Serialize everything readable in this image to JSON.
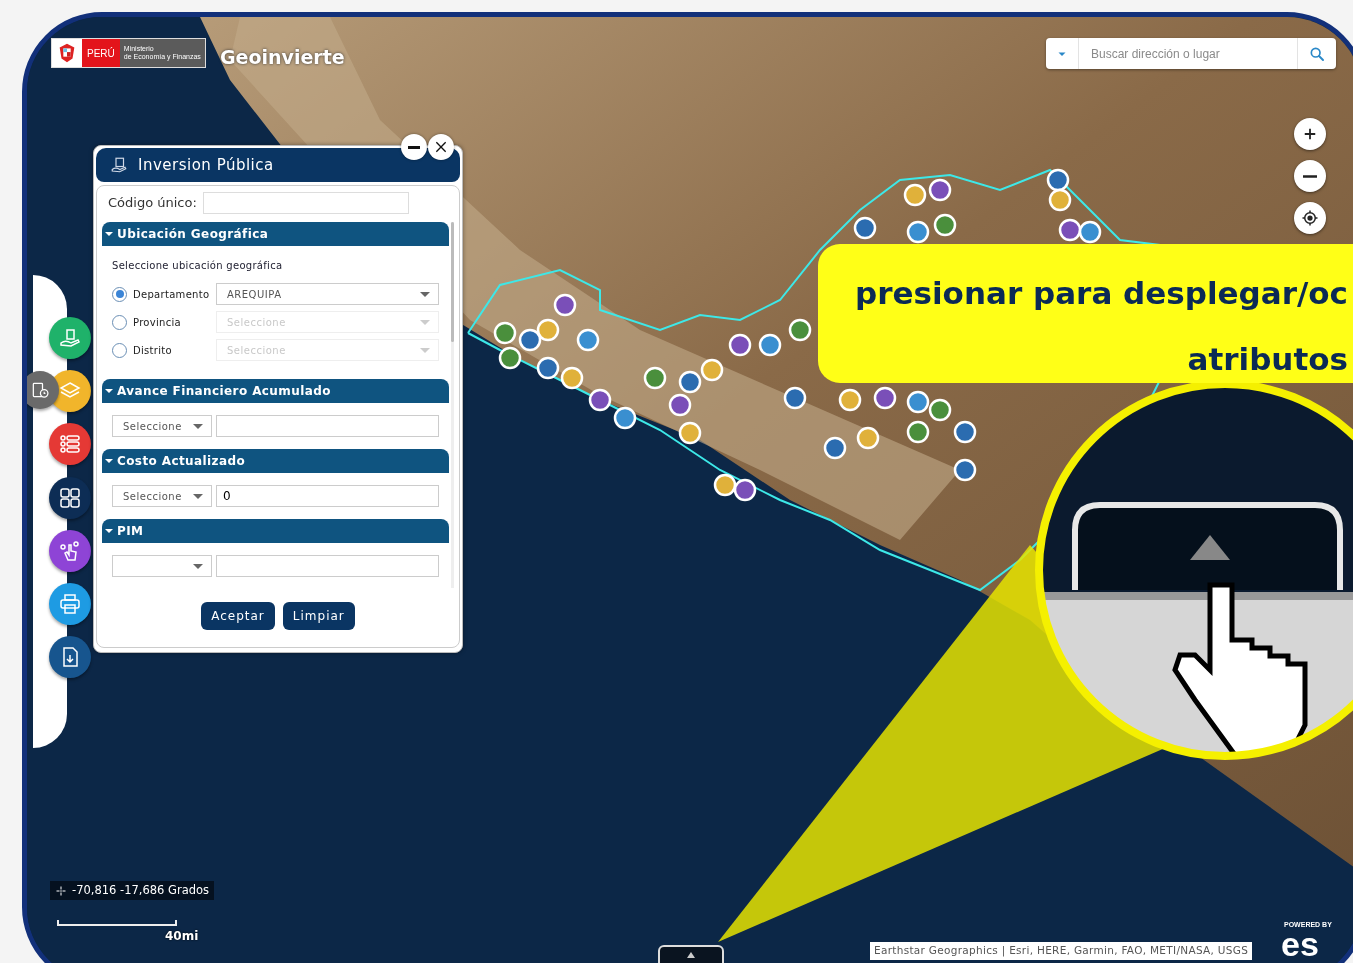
{
  "header": {
    "country": "PERÚ",
    "ministry": [
      "Ministerio",
      "de Economía y Finanzas"
    ],
    "app_title": "Geoinvierte"
  },
  "search": {
    "placeholder": "Buscar dirección o lugar"
  },
  "toolbar": {
    "tools": [
      {
        "color": "#1fb26a"
      },
      {
        "color": "#f1b52b"
      },
      {
        "color": "#e53935"
      },
      {
        "color": "#0d2d55"
      },
      {
        "color": "#8e44d6"
      },
      {
        "color": "#1e9be3"
      },
      {
        "color": "#17558e"
      }
    ]
  },
  "panel": {
    "title": "Inversion Pública",
    "code_label": "Código único:",
    "sections": [
      {
        "kind": "location",
        "title": "Ubicación Geográfica",
        "expanded": true,
        "hint": "Seleccione ubicación geográfica",
        "levels": [
          {
            "label": "Departamento",
            "selected": true,
            "value": "AREQUIPA",
            "disabled": false
          },
          {
            "label": "Provincia",
            "selected": false,
            "value": "Seleccione",
            "disabled": true
          },
          {
            "label": "Distrito",
            "selected": false,
            "value": "Seleccione",
            "disabled": true
          }
        ]
      },
      {
        "kind": "range",
        "title": "Avance Financiero Acumulado",
        "expanded": true,
        "operator": "Seleccione"
      },
      {
        "kind": "range",
        "title": "Costo Actualizado",
        "expanded": true,
        "operator": "Seleccione",
        "value": "0"
      },
      {
        "kind": "range",
        "title": "PIM",
        "expanded": true
      }
    ],
    "buttons": [
      "Aceptar",
      "Limpiar"
    ]
  },
  "coordinates": "-70,816 -17,686 Grados",
  "scale": "40mi",
  "attribution": "Earthstar Geographics | Esri, HERE, Garmin, FAO, METI/NASA, USGS",
  "esri": {
    "powered": "POWERED BY",
    "brand": "es"
  },
  "annotation": {
    "text": "presionar para desplegar/oc\natributos"
  }
}
